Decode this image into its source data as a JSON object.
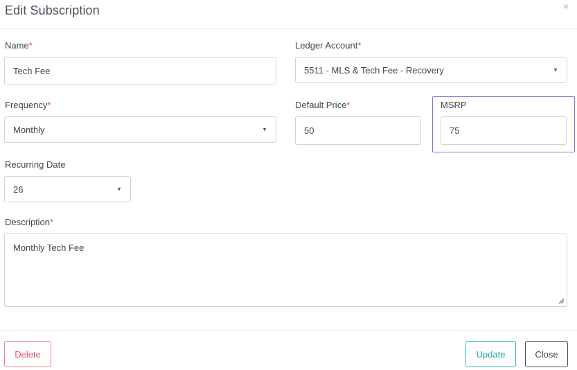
{
  "modal": {
    "title": "Edit Subscription",
    "close_glyph": "×"
  },
  "fields": {
    "name": {
      "label": "Name",
      "required_mark": "*",
      "value": "Tech Fee"
    },
    "ledger_account": {
      "label": "Ledger Account",
      "required_mark": "*",
      "value": "5511 - MLS & Tech Fee - Recovery"
    },
    "frequency": {
      "label": "Frequency",
      "required_mark": "*",
      "value": "Monthly"
    },
    "default_price": {
      "label": "Default Price",
      "required_mark": "*",
      "value": "50"
    },
    "msrp": {
      "label": "MSRP",
      "value": "75"
    },
    "recurring_date": {
      "label": "Recurring Date",
      "value": "26"
    },
    "description": {
      "label": "Description",
      "required_mark": "*",
      "value": "Monthly Tech Fee"
    }
  },
  "buttons": {
    "delete": "Delete",
    "update": "Update",
    "close": "Close"
  },
  "icons": {
    "caret": "▼",
    "close": "close-icon",
    "resize": "resize-grip-icon"
  },
  "colors": {
    "required": "#e04a5f",
    "highlight": "#8e6fd6",
    "update": "#1ea7a2",
    "delete": "#e0566a"
  }
}
